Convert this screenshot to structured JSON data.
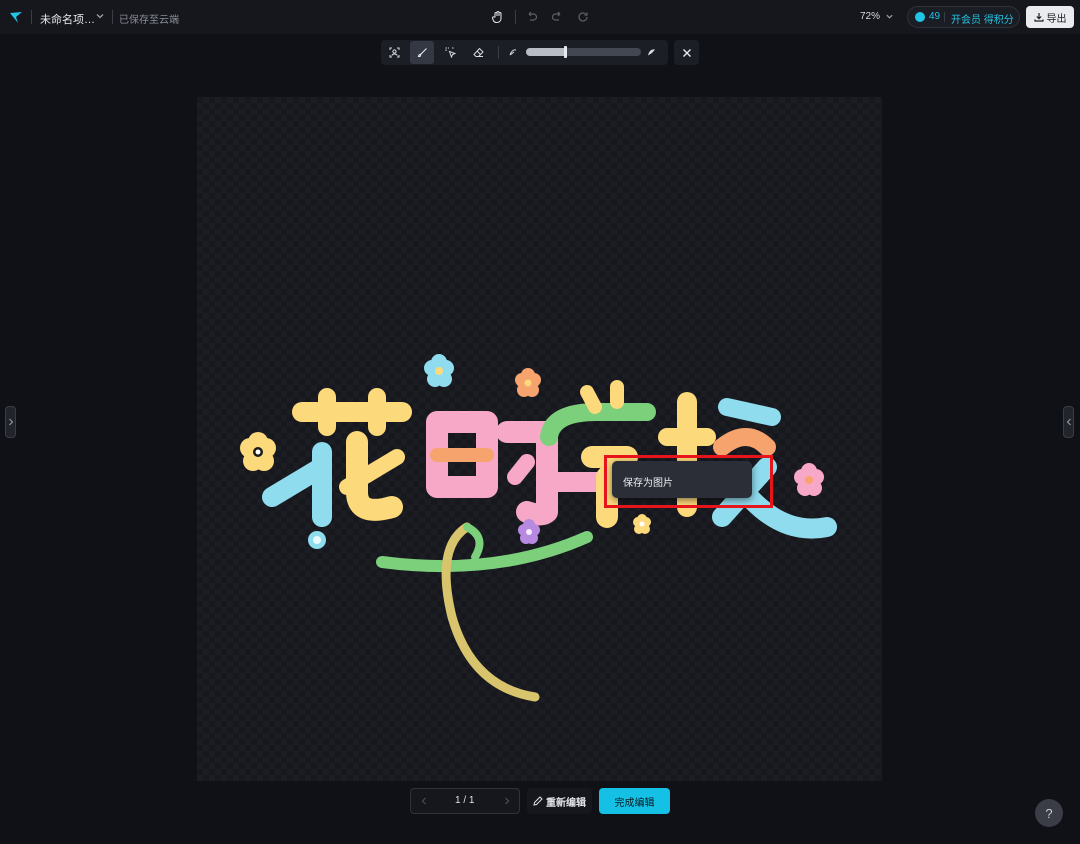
{
  "topbar": {
    "project_name": "未命名项…",
    "saved_status": "已保存至云端",
    "zoom_label": "72%",
    "points": "49",
    "member_link": "开会员 得积分",
    "export_label": "导出"
  },
  "toolbar": {
    "tools": [
      "portrait-select-icon",
      "brush-icon",
      "smart-select-icon",
      "eraser-icon"
    ],
    "active_tool": "brush-icon",
    "brush_size_level": 0.34
  },
  "artwork": {
    "title": "花的学校",
    "colors": {
      "yellow": "#fcd97a",
      "pink": "#f7a8c6",
      "green": "#7ccf7b",
      "blue": "#8fdcef",
      "orange": "#f6a36d",
      "purple": "#b889e0"
    }
  },
  "context_menu": {
    "item_label": "保存为图片"
  },
  "footer": {
    "page_indicator": "1 / 1",
    "reedit_label": "重新编辑",
    "done_label": "完成编辑"
  },
  "help": {
    "label": "?"
  },
  "accent_color": "#14c0e3",
  "highlight_color": "#e8141b"
}
